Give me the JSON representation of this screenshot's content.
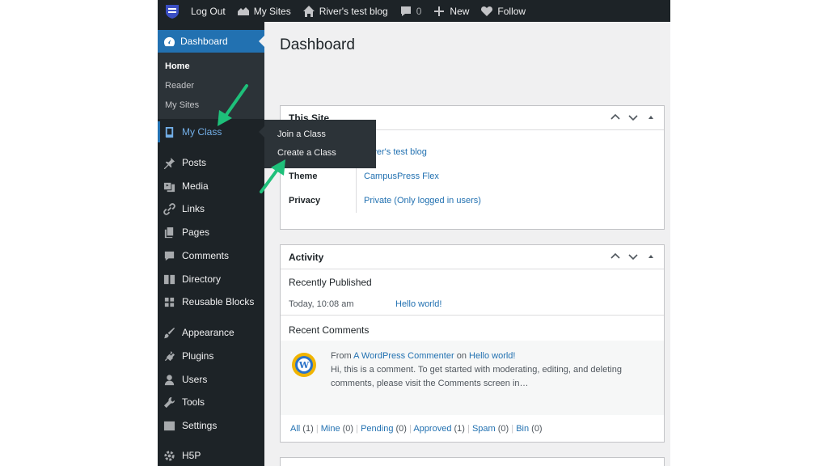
{
  "adminbar": {
    "logout": "Log Out",
    "my_sites": "My Sites",
    "site_name": "River's test blog",
    "comments_count": "0",
    "new": "New",
    "follow": "Follow"
  },
  "sidebar": {
    "dashboard": "Dashboard",
    "sub": [
      "Home",
      "Reader",
      "My Sites"
    ],
    "items": [
      "My Class",
      "Posts",
      "Media",
      "Links",
      "Pages",
      "Comments",
      "Directory",
      "Reusable Blocks",
      "Appearance",
      "Plugins",
      "Users",
      "Tools",
      "Settings",
      "H5P"
    ]
  },
  "flyout": [
    "Join a Class",
    "Create a Class"
  ],
  "page": {
    "title": "Dashboard"
  },
  "this_site": {
    "title": "This Site",
    "rows": [
      {
        "label": "",
        "value": "River's test blog"
      },
      {
        "label": "Theme",
        "value": "CampusPress Flex"
      },
      {
        "label": "Privacy",
        "value": "Private (Only logged in users)"
      }
    ]
  },
  "activity": {
    "title": "Activity",
    "recently_published": "Recently Published",
    "post_date": "Today, 10:08 am",
    "post_title": "Hello world!",
    "recent_comments": "Recent Comments",
    "comment": {
      "from": "From",
      "author": "A WordPress Commenter",
      "on": "on",
      "post": "Hello world!",
      "text_line1": "Hi, this is a comment. To get started with moderating, editing, and deleting",
      "text_line2": "comments, please visit the Comments screen in…"
    },
    "filters": [
      {
        "label": "All",
        "count": "(1)"
      },
      {
        "label": "Mine",
        "count": "(0)"
      },
      {
        "label": "Pending",
        "count": "(0)"
      },
      {
        "label": "Approved",
        "count": "(1)"
      },
      {
        "label": "Spam",
        "count": "(0)"
      },
      {
        "label": "Bin",
        "count": "(0)"
      }
    ]
  },
  "colors": {
    "admin_dark": "#1d2327",
    "accent": "#2271b1",
    "link": "#2271b1",
    "annotation_arrow": "#1ec07a"
  },
  "icons": [
    "site-logo-icon",
    "my-sites-icon",
    "home-icon",
    "comment-icon",
    "plus-icon",
    "heart-icon",
    "dashboard-icon",
    "book-icon",
    "pin-icon",
    "media-icon",
    "link-icon",
    "pages-icon",
    "comments-icon",
    "directory-icon",
    "blocks-icon",
    "brush-icon",
    "plugin-icon",
    "users-icon",
    "wrench-icon",
    "settings-icon",
    "gear-icon",
    "chevron-up-icon",
    "chevron-down-icon",
    "triangle-up-icon"
  ]
}
